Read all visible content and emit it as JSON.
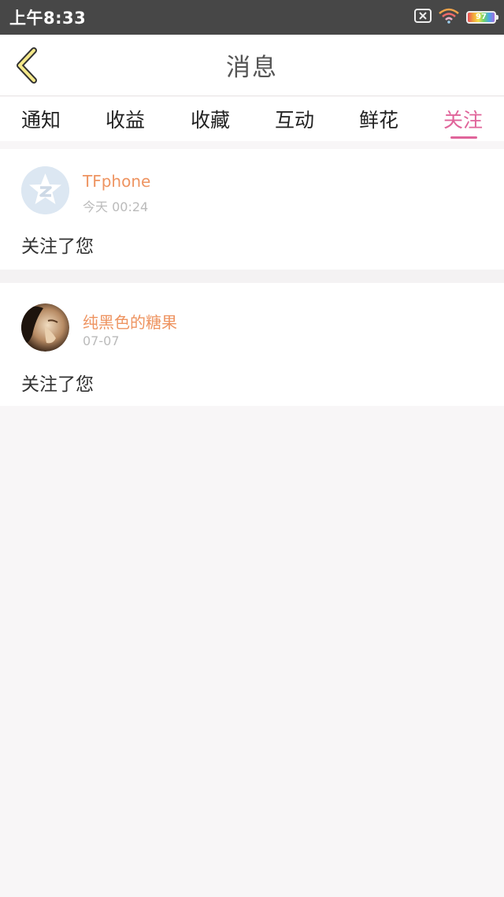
{
  "status_bar": {
    "time": "上午8:33",
    "battery": "97",
    "icons": [
      "sim-off-icon",
      "wifi-icon",
      "battery-icon"
    ]
  },
  "header": {
    "title": "消息",
    "back_icon": "chevron-left-icon"
  },
  "tabs": [
    {
      "label": "通知",
      "active": false
    },
    {
      "label": "收益",
      "active": false
    },
    {
      "label": "收藏",
      "active": false
    },
    {
      "label": "互动",
      "active": false
    },
    {
      "label": "鲜花",
      "active": false
    },
    {
      "label": "关注",
      "active": true
    }
  ],
  "messages": [
    {
      "username": "TFphone",
      "time": "今天 00:24",
      "text": "关注了您",
      "avatar": "default-star-avatar"
    },
    {
      "username": "纯黑色的糖果",
      "time": "07-07",
      "text": "关注了您",
      "avatar": "photo-avatar"
    }
  ],
  "colors": {
    "accent": "#e0649a",
    "username": "#ee9461",
    "status_bar": "#474747",
    "background": "#f8f6f7"
  }
}
